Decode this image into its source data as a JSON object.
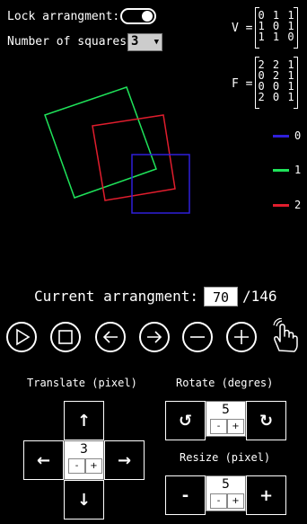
{
  "top": {
    "lock_label": "Lock arrangment:",
    "lock_on": true,
    "squares_label": "Number of squares:",
    "squares_value": "3"
  },
  "matrices": {
    "v_label": "V =",
    "v_rows": [
      "0 1 1",
      "1 0 1",
      "1 1 0"
    ],
    "f_label": "F =",
    "f_rows": [
      "2 2 1",
      "0 2 1",
      "0 0 1",
      "2 0 1"
    ]
  },
  "legend": [
    {
      "label": "0",
      "color": "#2f1fd9"
    },
    {
      "label": "1",
      "color": "#1fe35a"
    },
    {
      "label": "2",
      "color": "#e01d2d"
    }
  ],
  "arrangement": {
    "label": "Current arrangment:",
    "current": "70",
    "total": "/146"
  },
  "controls": [
    {
      "name": "play-icon"
    },
    {
      "name": "stop-icon"
    },
    {
      "name": "arrow-left-circle-icon"
    },
    {
      "name": "arrow-right-circle-icon"
    },
    {
      "name": "minus-circle-icon"
    },
    {
      "name": "plus-circle-icon"
    },
    {
      "name": "pointer-hand-icon"
    }
  ],
  "translate": {
    "title": "Translate (pixel)",
    "up": "↑",
    "down": "↓",
    "left": "←",
    "right": "→",
    "value": "3",
    "minus": "-",
    "plus": "+"
  },
  "rotate": {
    "title": "Rotate (degres)",
    "ccw": "↺",
    "cw": "↻",
    "value": "5",
    "minus": "-",
    "plus": "+"
  },
  "resize": {
    "title": "Resize (pixel)",
    "shrink": "-",
    "grow": "+",
    "value": "5",
    "minus": "-",
    "plus": "+"
  }
}
